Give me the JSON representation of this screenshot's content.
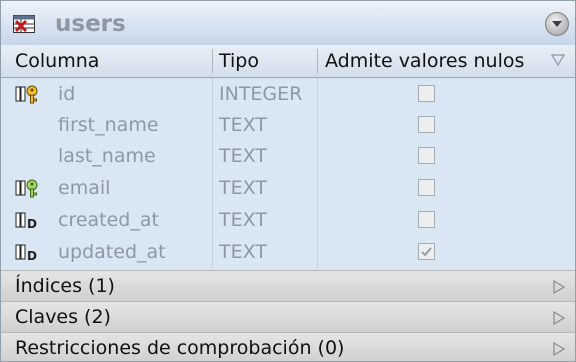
{
  "table": {
    "name": "users"
  },
  "columns_header": {
    "name": "Columna",
    "type": "Tipo",
    "nullable": "Admite valores nulos"
  },
  "rows": [
    {
      "name": "id",
      "type": "INTEGER",
      "icon": "primary-key-icon",
      "nullable_checked": false
    },
    {
      "name": "first_name",
      "type": "TEXT",
      "icon": "",
      "nullable_checked": false
    },
    {
      "name": "last_name",
      "type": "TEXT",
      "icon": "",
      "nullable_checked": false
    },
    {
      "name": "email",
      "type": "TEXT",
      "icon": "unique-key-icon",
      "nullable_checked": false
    },
    {
      "name": "created_at",
      "type": "TEXT",
      "icon": "default-value-icon",
      "nullable_checked": false
    },
    {
      "name": "updated_at",
      "type": "TEXT",
      "icon": "default-value-icon",
      "nullable_checked": true
    }
  ],
  "sections": [
    {
      "label": "Índices (1)"
    },
    {
      "label": "Claves (2)"
    },
    {
      "label": "Restricciones de comprobación (0)"
    }
  ]
}
